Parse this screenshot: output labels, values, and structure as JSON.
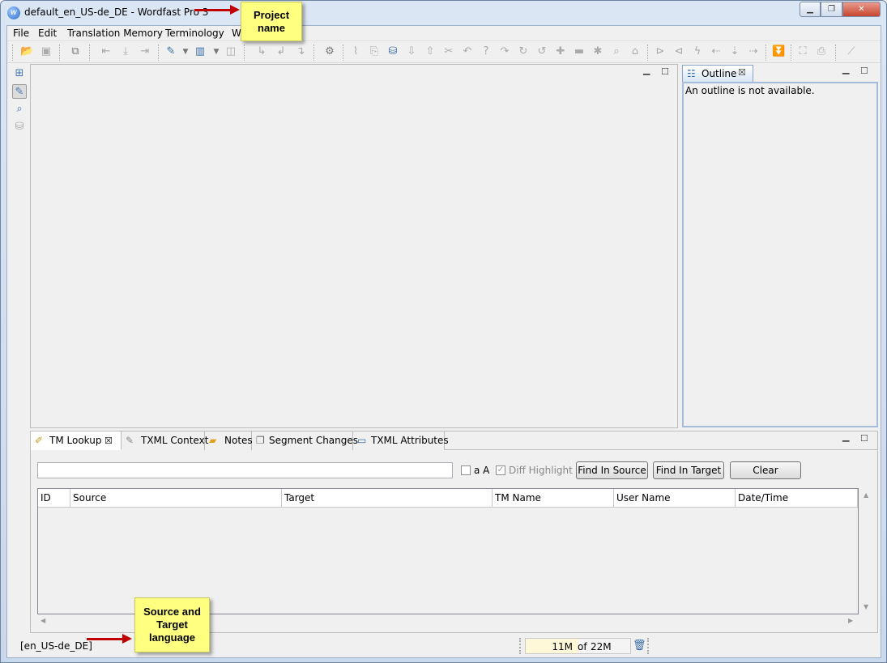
{
  "window": {
    "title": "default_en_US-de_DE - Wordfast Pro 3",
    "app_icon": "w"
  },
  "menu": {
    "items": [
      "File",
      "Edit",
      "Translation Memory",
      "Terminology",
      "Wi"
    ]
  },
  "outline": {
    "tab_label": "Outline",
    "message": "An outline is not available."
  },
  "bottom_tabs": {
    "items": [
      {
        "label": "TM Lookup",
        "icon": "pushpin-icon"
      },
      {
        "label": "TXML Context",
        "icon": "context-icon"
      },
      {
        "label": "Notes",
        "icon": "note-icon"
      },
      {
        "label": "Segment Changes",
        "icon": "copy-icon"
      },
      {
        "label": "TXML Attributes",
        "icon": "attributes-icon"
      }
    ]
  },
  "tm_lookup": {
    "search_value": "",
    "case_label": "a A",
    "diff_label": "Diff Highlight",
    "find_source": "Find In Source",
    "find_target": "Find In Target",
    "clear": "Clear",
    "columns": [
      "ID",
      "Source",
      "Target",
      "TM Name",
      "User Name",
      "Date/Time"
    ]
  },
  "status": {
    "language": "[en_US-de_DE]",
    "heap_used": "11M",
    "heap_separator": "of",
    "heap_total": "22M",
    "heap_fraction": 0.5
  },
  "callouts": {
    "project": "Project name",
    "language": "Source and Target language"
  },
  "colors": {
    "callout": "#ffff80",
    "arrow": "#c00000",
    "outline_border": "#a6bcda"
  }
}
